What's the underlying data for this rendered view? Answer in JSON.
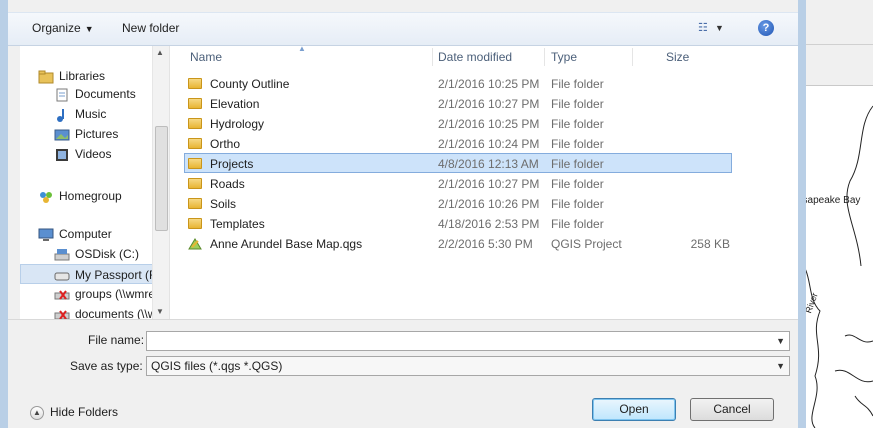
{
  "toolbar": {
    "organize_label": "Organize",
    "new_folder_label": "New folder"
  },
  "nav": {
    "items": [
      {
        "label": "Libraries",
        "icon": "libraries-icon"
      },
      {
        "label": "Documents",
        "icon": "documents-icon"
      },
      {
        "label": "Music",
        "icon": "music-icon"
      },
      {
        "label": "Pictures",
        "icon": "pictures-icon"
      },
      {
        "label": "Videos",
        "icon": "videos-icon"
      },
      {
        "label": "Homegroup",
        "icon": "homegroup-icon"
      },
      {
        "label": "Computer",
        "icon": "computer-icon"
      },
      {
        "label": "OSDisk (C:)",
        "icon": "drive-icon"
      },
      {
        "label": "My Passport (F:)",
        "icon": "drive-icon"
      },
      {
        "label": "groups (\\\\wmrec",
        "icon": "network-drive-icon"
      },
      {
        "label": "documents (\\\\wr",
        "icon": "network-drive-icon"
      }
    ],
    "selected": "My Passport (F:)"
  },
  "columns": {
    "name": "Name",
    "date": "Date modified",
    "type": "Type",
    "size": "Size"
  },
  "files": [
    {
      "name": "County Outline",
      "date": "2/1/2016 10:25 PM",
      "type": "File folder",
      "size": "",
      "icon": "folder-icon"
    },
    {
      "name": "Elevation",
      "date": "2/1/2016 10:27 PM",
      "type": "File folder",
      "size": "",
      "icon": "folder-icon"
    },
    {
      "name": "Hydrology",
      "date": "2/1/2016 10:25 PM",
      "type": "File folder",
      "size": "",
      "icon": "folder-icon"
    },
    {
      "name": "Ortho",
      "date": "2/1/2016 10:24 PM",
      "type": "File folder",
      "size": "",
      "icon": "folder-icon"
    },
    {
      "name": "Projects",
      "date": "4/8/2016 12:13 AM",
      "type": "File folder",
      "size": "",
      "icon": "folder-icon",
      "selected": true
    },
    {
      "name": "Roads",
      "date": "2/1/2016 10:27 PM",
      "type": "File folder",
      "size": "",
      "icon": "folder-icon"
    },
    {
      "name": "Soils",
      "date": "2/1/2016 10:26 PM",
      "type": "File folder",
      "size": "",
      "icon": "folder-icon"
    },
    {
      "name": "Templates",
      "date": "4/18/2016 2:53 PM",
      "type": "File folder",
      "size": "",
      "icon": "folder-icon"
    },
    {
      "name": "Anne Arundel Base Map.qgs",
      "date": "2/2/2016 5:30 PM",
      "type": "QGIS Project",
      "size": "258 KB",
      "icon": "qgis-file-icon"
    }
  ],
  "form": {
    "file_name_label": "File name:",
    "file_name_value": "",
    "save_type_label": "Save as type:",
    "save_type_value": "QGIS files (*.qgs *.QGS)"
  },
  "footer": {
    "hide_folders_label": "Hide Folders",
    "open_label": "Open",
    "cancel_label": "Cancel"
  },
  "map": {
    "labels": [
      "esapeake Bay",
      "River"
    ]
  },
  "colors": {
    "selection": "#cde3fa",
    "dialog_frame": "#b9cfe6"
  }
}
